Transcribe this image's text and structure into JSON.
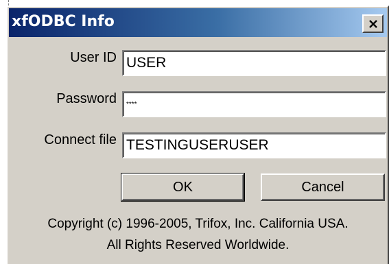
{
  "window": {
    "title": "xfODBC Info"
  },
  "form": {
    "user_id_label": "User ID",
    "user_id_value": "USER",
    "password_label": "Password",
    "password_value": "****",
    "connect_file_label": "Connect file",
    "connect_file_value": "TESTINGUSERUSER"
  },
  "buttons": {
    "ok_label": "OK",
    "cancel_label": "Cancel"
  },
  "footer": {
    "copyright_line1": "Copyright (c) 1996-2005, Trifox, Inc. California USA.",
    "copyright_line2": "All Rights Reserved Worldwide."
  },
  "icons": {
    "close": "close-icon"
  },
  "colors": {
    "title_gradient_start": "#0a246a",
    "title_gradient_end": "#a6caf0",
    "dialog_face": "#d4d0c8"
  }
}
